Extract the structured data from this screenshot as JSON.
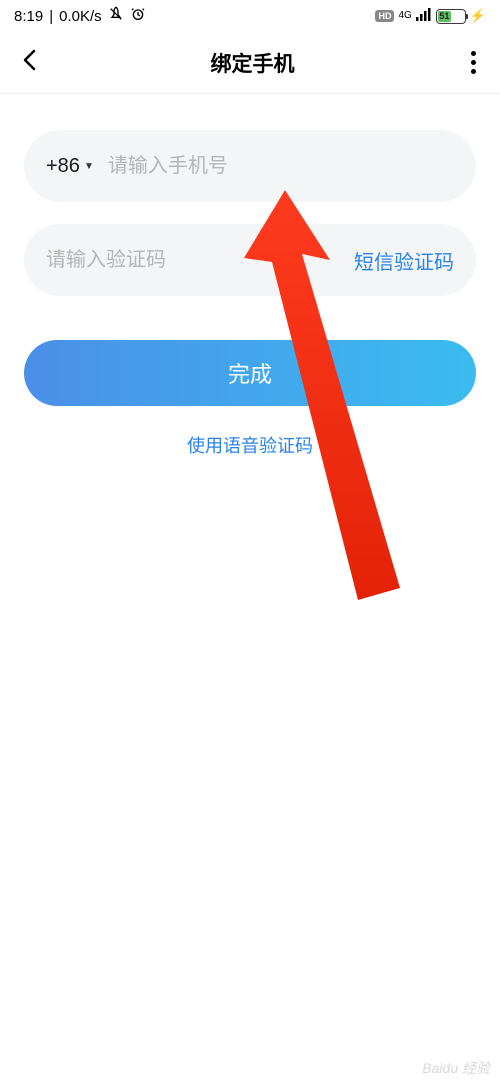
{
  "status": {
    "time": "8:19",
    "net_speed": "0.0K/s",
    "hd": "HD",
    "net_gen": "4G",
    "battery_pct": "51"
  },
  "nav": {
    "title": "绑定手机"
  },
  "form": {
    "country_code": "+86",
    "phone_placeholder": "请输入手机号",
    "code_placeholder": "请输入验证码",
    "sms_button": "短信验证码",
    "submit": "完成",
    "voice_link": "使用语音验证码"
  },
  "watermark": "Baidu 经验"
}
